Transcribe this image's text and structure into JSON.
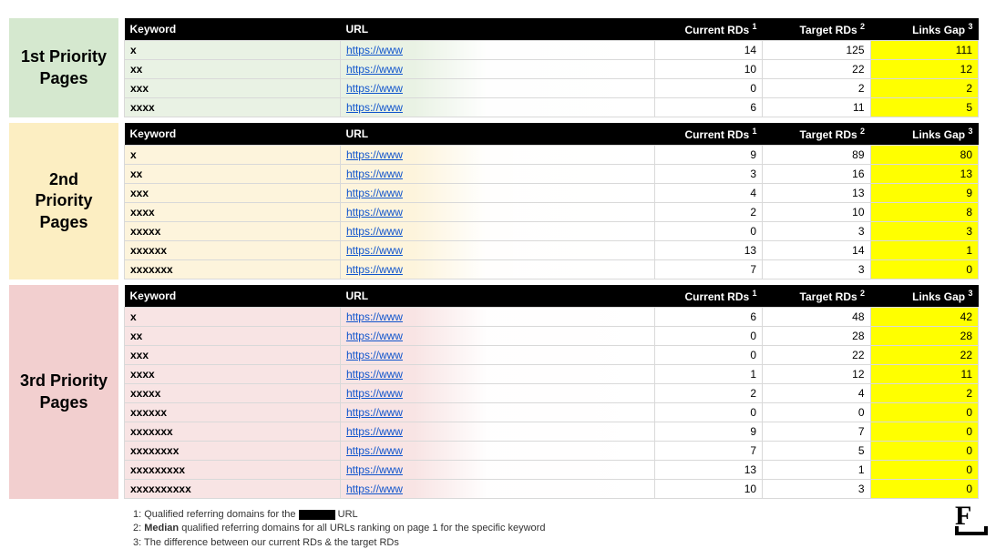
{
  "headers": {
    "keyword": "Keyword",
    "url": "URL",
    "current_rds": "Current RDs",
    "current_rds_sup": "1",
    "target_rds": "Target RDs",
    "target_rds_sup": "2",
    "links_gap": "Links Gap",
    "links_gap_sup": "3"
  },
  "groups": [
    {
      "label": "1st Priority Pages",
      "class": "g1",
      "label_class": "g1-label",
      "rows": [
        {
          "keyword": "x",
          "url": "https://www",
          "current": "14",
          "target": "125",
          "gap": "111"
        },
        {
          "keyword": "xx",
          "url": "https://www",
          "current": "10",
          "target": "22",
          "gap": "12"
        },
        {
          "keyword": "xxx",
          "url": "https://www",
          "current": "0",
          "target": "2",
          "gap": "2"
        },
        {
          "keyword": "xxxx",
          "url": "https://www",
          "current": "6",
          "target": "11",
          "gap": "5"
        }
      ]
    },
    {
      "label": "2nd Priority Pages",
      "class": "g2",
      "label_class": "g2-label",
      "rows": [
        {
          "keyword": "x",
          "url": "https://www",
          "current": "9",
          "target": "89",
          "gap": "80"
        },
        {
          "keyword": "xx",
          "url": "https://www",
          "current": "3",
          "target": "16",
          "gap": "13"
        },
        {
          "keyword": "xxx",
          "url": "https://www",
          "current": "4",
          "target": "13",
          "gap": "9"
        },
        {
          "keyword": "xxxx",
          "url": "https://www",
          "current": "2",
          "target": "10",
          "gap": "8"
        },
        {
          "keyword": "xxxxx",
          "url": "https://www",
          "current": "0",
          "target": "3",
          "gap": "3"
        },
        {
          "keyword": "xxxxxx",
          "url": "https://www",
          "current": "13",
          "target": "14",
          "gap": "1"
        },
        {
          "keyword": "xxxxxxx",
          "url": "https://www",
          "current": "7",
          "target": "3",
          "gap": "0"
        }
      ]
    },
    {
      "label": "3rd Priority Pages",
      "class": "g3",
      "label_class": "g3-label",
      "rows": [
        {
          "keyword": "x",
          "url": "https://www",
          "current": "6",
          "target": "48",
          "gap": "42"
        },
        {
          "keyword": "xx",
          "url": "https://www",
          "current": "0",
          "target": "28",
          "gap": "28"
        },
        {
          "keyword": "xxx",
          "url": "https://www",
          "current": "0",
          "target": "22",
          "gap": "22"
        },
        {
          "keyword": "xxxx",
          "url": "https://www",
          "current": "1",
          "target": "12",
          "gap": "11"
        },
        {
          "keyword": "xxxxx",
          "url": "https://www",
          "current": "2",
          "target": "4",
          "gap": "2"
        },
        {
          "keyword": "xxxxxx",
          "url": "https://www",
          "current": "0",
          "target": "0",
          "gap": "0"
        },
        {
          "keyword": "xxxxxxx",
          "url": "https://www",
          "current": "9",
          "target": "7",
          "gap": "0"
        },
        {
          "keyword": "xxxxxxxx",
          "url": "https://www",
          "current": "7",
          "target": "5",
          "gap": "0"
        },
        {
          "keyword": "xxxxxxxxx",
          "url": "https://www",
          "current": "13",
          "target": "1",
          "gap": "0"
        },
        {
          "keyword": "xxxxxxxxxx",
          "url": "https://www",
          "current": "10",
          "target": "3",
          "gap": "0"
        }
      ]
    }
  ],
  "footnotes": {
    "f1_prefix": "1: Qualified referring domains for the ",
    "f1_suffix": " URL",
    "f2_prefix": "2: ",
    "f2_bold": "Median",
    "f2_suffix": " qualified referring domains for all URLs ranking on page 1 for the specific keyword",
    "f3": "3: The difference between our current RDs & the target RDs"
  },
  "logo": "F",
  "chart_data": {
    "type": "table",
    "title": "Priority Pages Link Gap Analysis",
    "columns": [
      "Priority",
      "Keyword",
      "URL",
      "Current RDs",
      "Target RDs",
      "Links Gap"
    ],
    "rows": [
      [
        "1st",
        "x",
        "https://www",
        14,
        125,
        111
      ],
      [
        "1st",
        "xx",
        "https://www",
        10,
        22,
        12
      ],
      [
        "1st",
        "xxx",
        "https://www",
        0,
        2,
        2
      ],
      [
        "1st",
        "xxxx",
        "https://www",
        6,
        11,
        5
      ],
      [
        "2nd",
        "x",
        "https://www",
        9,
        89,
        80
      ],
      [
        "2nd",
        "xx",
        "https://www",
        3,
        16,
        13
      ],
      [
        "2nd",
        "xxx",
        "https://www",
        4,
        13,
        9
      ],
      [
        "2nd",
        "xxxx",
        "https://www",
        2,
        10,
        8
      ],
      [
        "2nd",
        "xxxxx",
        "https://www",
        0,
        3,
        3
      ],
      [
        "2nd",
        "xxxxxx",
        "https://www",
        13,
        14,
        1
      ],
      [
        "2nd",
        "xxxxxxx",
        "https://www",
        7,
        3,
        0
      ],
      [
        "3rd",
        "x",
        "https://www",
        6,
        48,
        42
      ],
      [
        "3rd",
        "xx",
        "https://www",
        0,
        28,
        28
      ],
      [
        "3rd",
        "xxx",
        "https://www",
        0,
        22,
        22
      ],
      [
        "3rd",
        "xxxx",
        "https://www",
        1,
        12,
        11
      ],
      [
        "3rd",
        "xxxxx",
        "https://www",
        2,
        4,
        2
      ],
      [
        "3rd",
        "xxxxxx",
        "https://www",
        0,
        0,
        0
      ],
      [
        "3rd",
        "xxxxxxx",
        "https://www",
        9,
        7,
        0
      ],
      [
        "3rd",
        "xxxxxxxx",
        "https://www",
        7,
        5,
        0
      ],
      [
        "3rd",
        "xxxxxxxxx",
        "https://www",
        13,
        1,
        0
      ],
      [
        "3rd",
        "xxxxxxxxxx",
        "https://www",
        10,
        3,
        0
      ]
    ]
  }
}
